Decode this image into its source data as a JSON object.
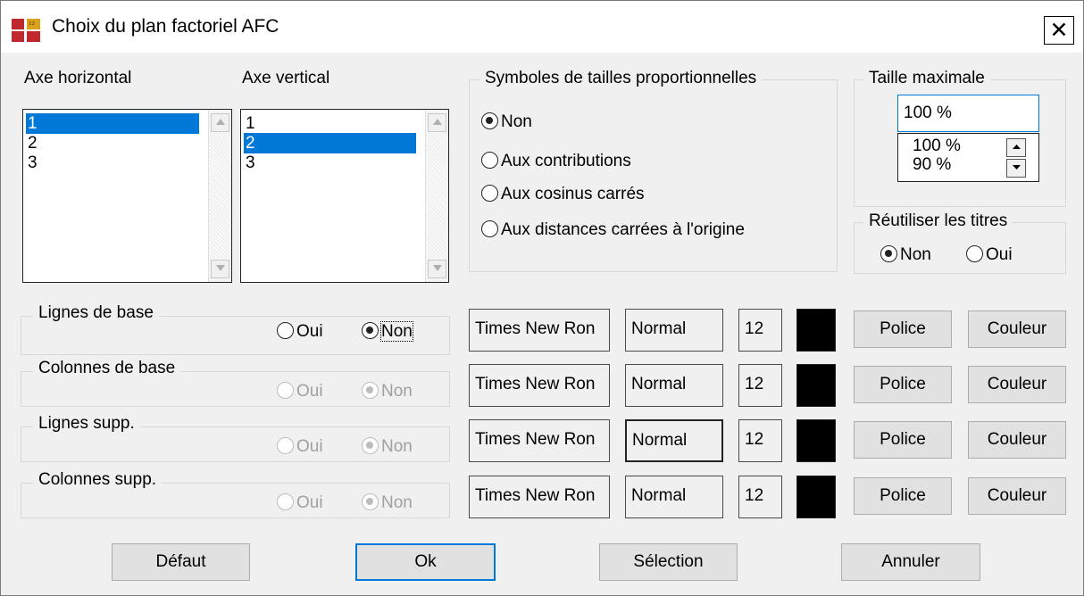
{
  "window": {
    "title": "Choix du plan factoriel AFC",
    "close_label": "✕"
  },
  "axes": {
    "horizontal_label": "Axe horizontal",
    "vertical_label": "Axe vertical",
    "horizontal_items": [
      "1",
      "2",
      "3"
    ],
    "horizontal_selected": 0,
    "vertical_items": [
      "1",
      "2",
      "3"
    ],
    "vertical_selected": 1
  },
  "symbols": {
    "title": "Symboles de tailles proportionnelles",
    "options": [
      "Non",
      "Aux contributions",
      "Aux cosinus carrés",
      "Aux distances carrées à l'origine"
    ],
    "selected": 0
  },
  "max_size": {
    "title": "Taille maximale",
    "value": "100 %",
    "options": [
      "100 %",
      "90 %"
    ]
  },
  "reuse_titles": {
    "title": "Réutiliser les titres",
    "options": [
      "Non",
      "Oui"
    ],
    "selected": 0
  },
  "rows": [
    {
      "label": "Lignes de base",
      "oui": "Oui",
      "non": "Non",
      "selected": "non",
      "enabled": true,
      "font": "Times New Ron",
      "style": "Normal",
      "size": "12",
      "color": "#000000",
      "font_button": "Police",
      "color_button": "Couleur"
    },
    {
      "label": "Colonnes de base",
      "oui": "Oui",
      "non": "Non",
      "selected": "non",
      "enabled": false,
      "font": "Times New Ron",
      "style": "Normal",
      "size": "12",
      "color": "#000000",
      "font_button": "Police",
      "color_button": "Couleur"
    },
    {
      "label": "Lignes supp.",
      "oui": "Oui",
      "non": "Non",
      "selected": "non",
      "enabled": false,
      "font": "Times New Ron",
      "style": "Normal",
      "size": "12",
      "color": "#000000",
      "font_button": "Police",
      "color_button": "Couleur"
    },
    {
      "label": "Colonnes supp.",
      "oui": "Oui",
      "non": "Non",
      "selected": "non",
      "enabled": false,
      "font": "Times New Ron",
      "style": "Normal",
      "size": "12",
      "color": "#000000",
      "font_button": "Police",
      "color_button": "Couleur"
    }
  ],
  "buttons": {
    "default": "Défaut",
    "ok": "Ok",
    "selection": "Sélection",
    "cancel": "Annuler"
  },
  "colors": {
    "selection": "#0078d7",
    "disabled_text": "#a0a0a0",
    "icon_red": "#c0282d",
    "icon_gold": "#d9a21b"
  }
}
